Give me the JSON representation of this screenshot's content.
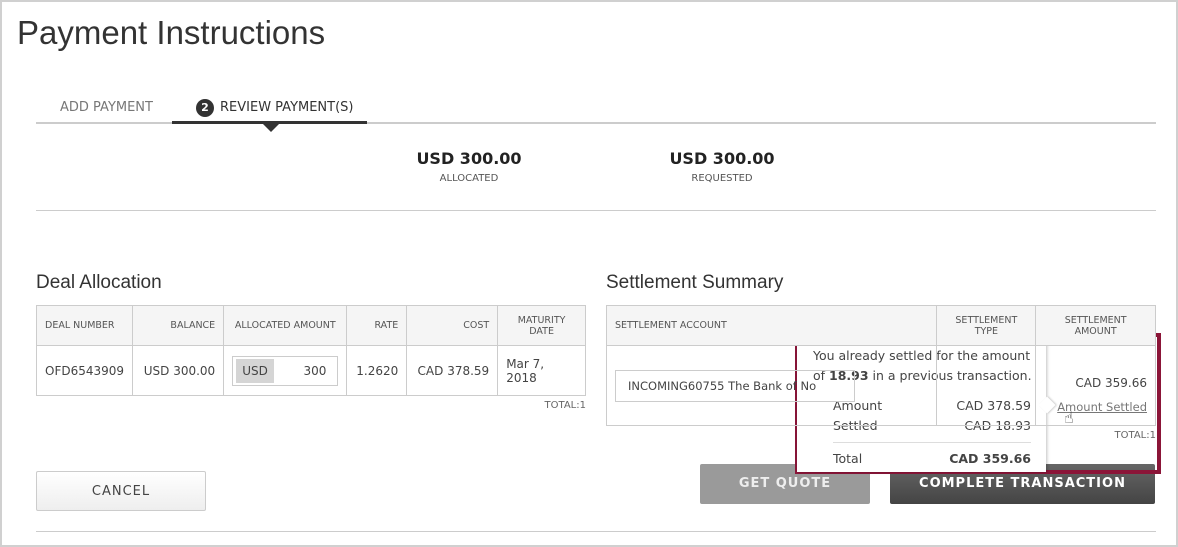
{
  "page": {
    "title": "Payment Instructions"
  },
  "tabs": [
    {
      "label": "ADD PAYMENT"
    },
    {
      "step": "2",
      "label": "REVIEW PAYMENT(S)",
      "active": true
    }
  ],
  "summary": [
    {
      "value": "USD 300.00",
      "label": "ALLOCATED"
    },
    {
      "value": "USD 300.00",
      "label": "REQUESTED"
    }
  ],
  "deal": {
    "title": "Deal Allocation",
    "headers": [
      "DEAL NUMBER",
      "BALANCE",
      "ALLOCATED AMOUNT",
      "RATE",
      "COST",
      "MATURITY DATE"
    ],
    "row": {
      "deal_number": "OFD6543909",
      "balance": "USD 300.00",
      "currency": "USD",
      "amount": "300",
      "rate": "1.2620",
      "cost": "CAD 378.59",
      "maturity": "Mar 7, 2018"
    },
    "total": "TOTAL:1"
  },
  "settlement": {
    "title": "Settlement Summary",
    "headers": [
      "SETTLEMENT ACCOUNT",
      "SETTLEMENT TYPE",
      "SETTLEMENT AMOUNT"
    ],
    "row": {
      "account": "INCOMING60755 The Bank of No",
      "amount": "CAD 359.66",
      "link": "Amount Settled"
    },
    "total": "TOTAL:1"
  },
  "tooltip": {
    "line1": "You already settled for the amount",
    "line2_pre": "of ",
    "line2_amount": "18.93",
    "line2_post": " in a previous transaction.",
    "rows": [
      {
        "label": "Amount",
        "value": "CAD 378.59"
      },
      {
        "label": "Settled",
        "value": "CAD 18.93"
      }
    ],
    "total_label": "Total",
    "total_value": "CAD 359.66"
  },
  "buttons": {
    "cancel": "CANCEL",
    "get_quote": "GET QUOTE",
    "complete": "COMPLETE TRANSACTION"
  },
  "colors": {
    "highlight": "#8b1538",
    "primary_button": "#555555",
    "disabled_button": "#9a9a9a"
  }
}
